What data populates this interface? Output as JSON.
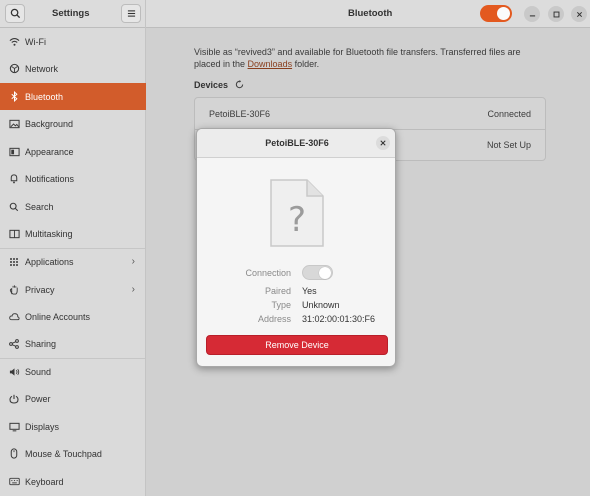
{
  "header": {
    "app_title": "Settings",
    "page_title": "Bluetooth",
    "bluetooth_enabled": true,
    "search_icon": "search-icon",
    "menu_icon": "hamburger-menu-icon",
    "window_controls": [
      "minimize",
      "maximize",
      "close"
    ]
  },
  "sidebar": {
    "items": [
      {
        "label": "Wi-Fi",
        "icon": "wifi-icon"
      },
      {
        "label": "Network",
        "icon": "network-icon"
      },
      {
        "label": "Bluetooth",
        "icon": "bluetooth-icon",
        "active": true
      },
      {
        "label": "Background",
        "icon": "background-icon"
      },
      {
        "label": "Appearance",
        "icon": "appearance-icon"
      },
      {
        "label": "Notifications",
        "icon": "bell-icon"
      },
      {
        "label": "Search",
        "icon": "search-icon"
      },
      {
        "label": "Multitasking",
        "icon": "multitasking-icon"
      },
      {
        "label": "Applications",
        "icon": "applications-icon",
        "chevron": true
      },
      {
        "label": "Privacy",
        "icon": "hand-icon",
        "chevron": true
      },
      {
        "label": "Online Accounts",
        "icon": "cloud-icon"
      },
      {
        "label": "Sharing",
        "icon": "share-icon"
      },
      {
        "label": "Sound",
        "icon": "speaker-icon"
      },
      {
        "label": "Power",
        "icon": "power-icon"
      },
      {
        "label": "Displays",
        "icon": "display-icon"
      },
      {
        "label": "Mouse & Touchpad",
        "icon": "mouse-icon"
      },
      {
        "label": "Keyboard",
        "icon": "keyboard-icon"
      }
    ]
  },
  "main": {
    "visible_text_part1": "Visible as “revived3” and available for Bluetooth file transfers. Transferred files are placed in the ",
    "visible_link": "Downloads",
    "visible_text_part2": " folder.",
    "devices_label": "Devices",
    "devices": [
      {
        "name": "PetoiBLE-30F6",
        "status": "Connected"
      },
      {
        "name": "",
        "status": "Not Set Up"
      }
    ]
  },
  "dialog": {
    "title": "PetoiBLE-30F6",
    "icon": "unknown-file-icon",
    "connection_label": "Connection",
    "connection_on": false,
    "paired_label": "Paired",
    "paired_value": "Yes",
    "type_label": "Type",
    "type_value": "Unknown",
    "address_label": "Address",
    "address_value": "31:02:00:01:30:F6",
    "remove_label": "Remove Device"
  },
  "colors": {
    "accent": "#d25c2b",
    "toggle_on": "#e3591f",
    "destructive": "#d62a35"
  }
}
